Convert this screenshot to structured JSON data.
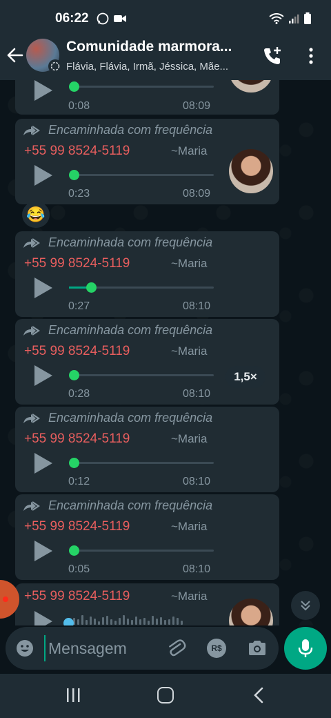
{
  "status_bar": {
    "time": "06:22"
  },
  "header": {
    "title": "Comunidade marmora...",
    "subtitle": "Flávia, Flávia, Irmã, Jéssica, Mãe..."
  },
  "messages": [
    {
      "forwarded_label": "",
      "sender": "",
      "pushname": "",
      "duration": "0:08",
      "time": "08:09",
      "progress": 0.0,
      "partial": true
    },
    {
      "forwarded_label": "Encaminhada com frequência",
      "sender": "+55 99 8524-5119",
      "pushname": "~Maria",
      "duration": "0:23",
      "time": "08:09",
      "progress": 0.0
    },
    {
      "forwarded_label": "Encaminhada com frequência",
      "sender": "+55 99 8524-5119",
      "pushname": "~Maria",
      "duration": "0:27",
      "time": "08:10",
      "progress": 0.12
    },
    {
      "forwarded_label": "Encaminhada com frequência",
      "sender": "+55 99 8524-5119",
      "pushname": "~Maria",
      "duration": "0:28",
      "time": "08:10",
      "progress": 0.0,
      "playback_speed": "1,5×"
    },
    {
      "forwarded_label": "Encaminhada com frequência",
      "sender": "+55 99 8524-5119",
      "pushname": "~Maria",
      "duration": "0:12",
      "time": "08:10",
      "progress": 0.0
    },
    {
      "forwarded_label": "Encaminhada com frequência",
      "sender": "+55 99 8524-5119",
      "pushname": "~Maria",
      "duration": "0:05",
      "time": "08:10",
      "progress": 0.0
    },
    {
      "forwarded_label": "",
      "sender": "+55 99 8524-5119",
      "pushname": "~Maria",
      "duration": "",
      "time": "",
      "progress": 0.0,
      "partial": true
    }
  ],
  "reaction": {
    "emoji": "😂"
  },
  "composer": {
    "placeholder": "Mensagem",
    "payment_label": "R$"
  },
  "colors": {
    "accent": "#00a884",
    "sender": "#e85e5e",
    "bubble": "#202c33",
    "bar": "#1f2c34"
  }
}
